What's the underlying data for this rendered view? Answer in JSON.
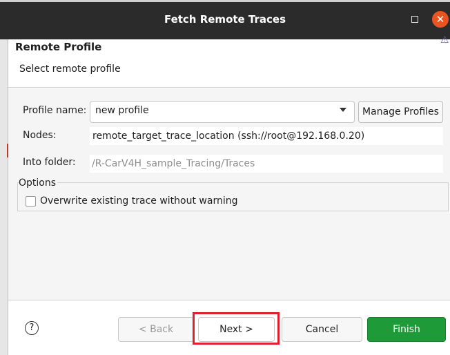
{
  "window": {
    "title": "Fetch Remote Traces",
    "maximize_icon": "maximize-icon",
    "close_icon": "close-icon",
    "close_glyph": "✕"
  },
  "header": {
    "title": "Remote Profile",
    "description": "Select remote profile",
    "warning_icon": "warning-icon"
  },
  "form": {
    "profile_label": "Profile name:",
    "profile_value": "new profile",
    "manage_profiles": "Manage Profiles",
    "nodes_label": "Nodes:",
    "nodes_value": "remote_target_trace_location (ssh://root@192.168.0.20)",
    "folder_label": "Into folder:",
    "folder_value": "/R-CarV4H_sample_Tracing/Traces"
  },
  "options": {
    "legend": "Options",
    "overwrite_label": "Overwrite existing trace without warning",
    "overwrite_checked": false
  },
  "footer": {
    "help_glyph": "?",
    "back": "< Back",
    "next": "Next >",
    "cancel": "Cancel",
    "finish": "Finish"
  },
  "colors": {
    "titlebar": "#2b2b2b",
    "close": "#e95420",
    "finish": "#1e9a38",
    "highlight": "#e0202c"
  }
}
